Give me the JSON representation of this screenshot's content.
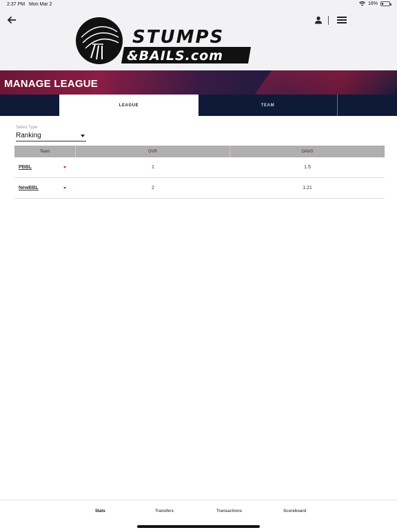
{
  "status": {
    "time": "2:37 PM",
    "date": "Mon Mar 2",
    "battery_text": "16%",
    "battery_level": 0.16
  },
  "header": {
    "logo_text_top": "STUMPS",
    "logo_text_bottom": "&BAILS.com"
  },
  "banner": {
    "title": "MANAGE LEAGUE"
  },
  "tabs": [
    {
      "label": "LEAGUE",
      "active": true
    },
    {
      "label": "TEAM",
      "active": false
    }
  ],
  "select": {
    "label": "Select Type",
    "value": "Ranking"
  },
  "table": {
    "headers": [
      "Team",
      "OVR",
      "OAVG"
    ],
    "rows": [
      {
        "team": "PBBL",
        "ovr": "1",
        "oavg": "1.5"
      },
      {
        "team": "NewBBL",
        "ovr": "2",
        "oavg": "1.21"
      }
    ]
  },
  "bottom_nav": [
    {
      "label": "Stats",
      "active": true
    },
    {
      "label": "Transfers",
      "active": false
    },
    {
      "label": "Transactions",
      "active": false
    },
    {
      "label": "Scoreboard",
      "active": false
    }
  ],
  "colors": {
    "navy": "#0f1a38",
    "banner_maroon": "#8a1d43",
    "accent_red": "#b0203c",
    "table_header": "#b0aeae"
  },
  "icons": [
    "back-arrow-icon",
    "user-icon",
    "hamburger-menu-icon",
    "wifi-icon",
    "battery-icon",
    "dropdown-caret-icon"
  ]
}
